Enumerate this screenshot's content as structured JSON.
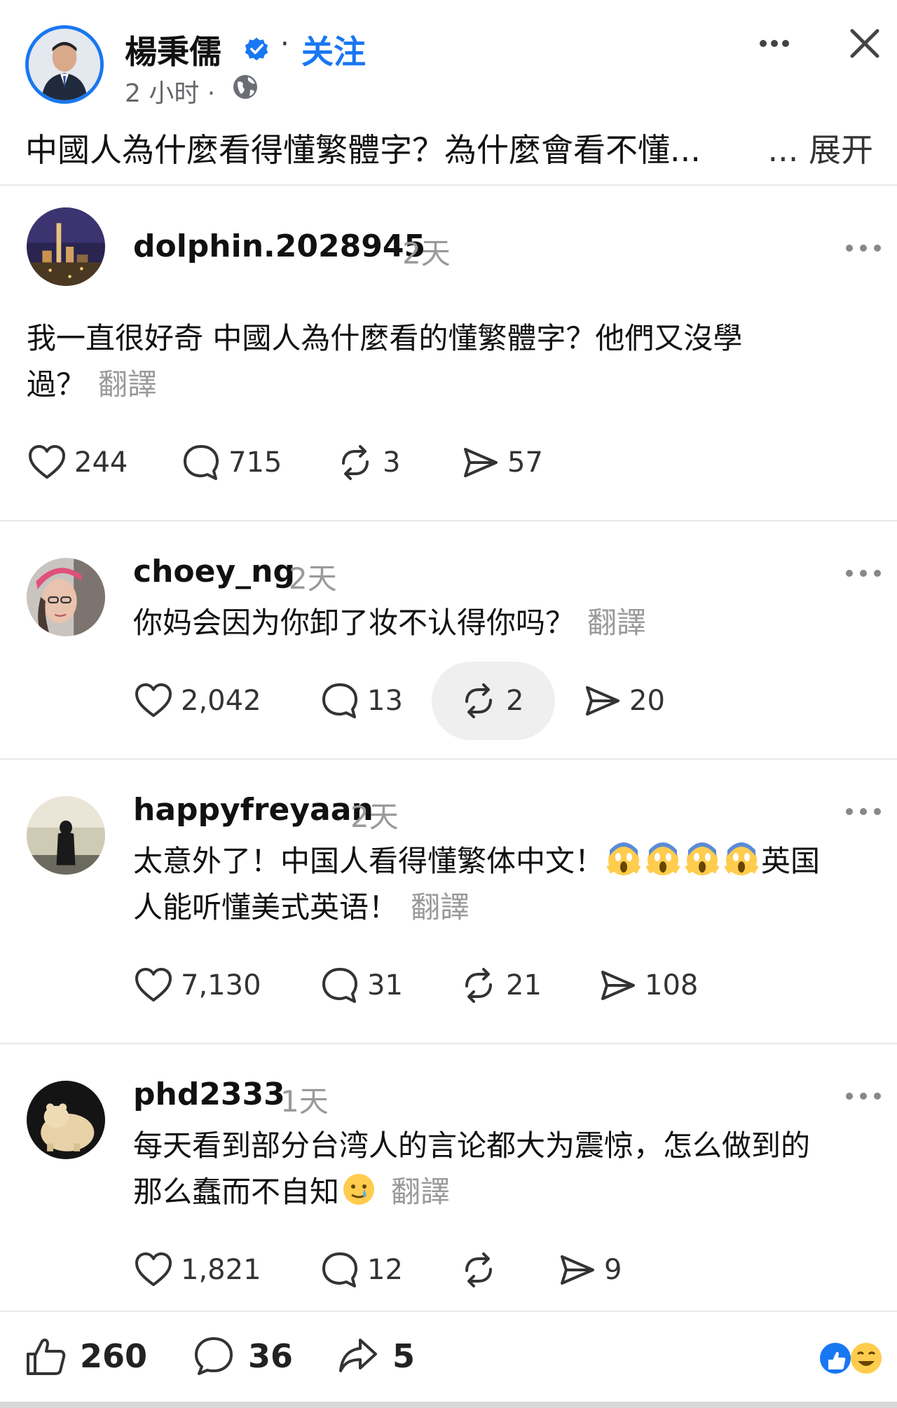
{
  "post": {
    "author": "楊秉儒",
    "separator": "·",
    "follow_label": "关注",
    "time": "2 小时 ·",
    "text": "中國人為什麼看得懂繁體字？為什麼會看不懂",
    "ellipsis": "...",
    "expand_label": "展开"
  },
  "comments": [
    {
      "username": "dolphin.2028945",
      "time": "2天",
      "text_line1": "我一直很好奇 中國人為什麼看的懂繁體字？他們又沒學",
      "text_line2": "過？",
      "translate_label": "翻譯",
      "likes": "244",
      "replies": "715",
      "reposts": "3",
      "shares": "57"
    },
    {
      "username": "choey_ng",
      "time": "2天",
      "text_line1": "你妈会因为你卸了妆不认得你吗？",
      "translate_label": "翻譯",
      "likes": "2,042",
      "replies": "13",
      "reposts": "2",
      "shares": "20"
    },
    {
      "username": "happyfreyaan",
      "time": "2天",
      "text_line1_a": "太意外了！中国人看得懂繁体中文！",
      "text_line1_b": "英国",
      "text_line2": "人能听懂美式英语！",
      "translate_label": "翻譯",
      "likes": "7,130",
      "replies": "31",
      "reposts": "21",
      "shares": "108"
    },
    {
      "username": "phd2333",
      "time": "1天",
      "text_line1": "每天看到部分台湾人的言论都大为震惊，怎么做到的",
      "text_line2": "那么蠢而不自知",
      "translate_label": "翻譯",
      "likes": "1,821",
      "replies": "12",
      "reposts": "",
      "shares": "9"
    }
  ],
  "footer": {
    "likes": "260",
    "comments": "36",
    "shares": "5"
  },
  "colors": {
    "accent": "#1877f2",
    "muted": "#9a9a9a",
    "divider": "#e7e7e7"
  },
  "icons": [
    "verified-icon",
    "globe-icon",
    "more-icon",
    "close-icon",
    "heart-icon",
    "comment-icon",
    "repost-icon",
    "share-icon",
    "thumbs-up-icon",
    "scream-emoji",
    "tear-smile-emoji",
    "reaction-icons"
  ]
}
